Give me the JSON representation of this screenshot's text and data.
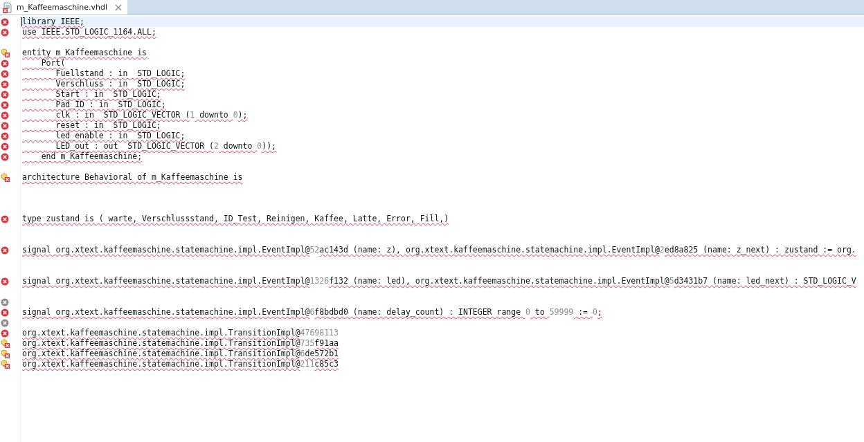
{
  "tab": {
    "title": "m_Kaffeemaschine.vhdl",
    "selected": true
  },
  "lines": [
    {
      "kind": "error",
      "current": true,
      "segments": [
        {
          "kind": "code",
          "text": "library IEEE;"
        }
      ]
    },
    {
      "kind": "error",
      "segments": [
        {
          "kind": "code",
          "text": "use IEEE.STD_LOGIC_1164.ALL;"
        }
      ]
    },
    {
      "kind": "plain"
    },
    {
      "kind": "quickfix",
      "segments": [
        {
          "kind": "code",
          "text": "entity m_Kaffeemaschine is"
        }
      ]
    },
    {
      "kind": "error",
      "segments": [
        {
          "kind": "code",
          "text": "    Port("
        }
      ]
    },
    {
      "kind": "error",
      "segments": [
        {
          "kind": "code",
          "text": "       Fuellstand : in  STD_LOGIC;"
        }
      ]
    },
    {
      "kind": "error",
      "segments": [
        {
          "kind": "code",
          "text": "       Verschluss : in  STD_LOGIC;"
        }
      ]
    },
    {
      "kind": "error",
      "segments": [
        {
          "kind": "code",
          "text": "       Start : in  STD_LOGIC;"
        }
      ]
    },
    {
      "kind": "error",
      "segments": [
        {
          "kind": "code",
          "text": "       Pad_ID : in  STD_LOGIC;"
        }
      ]
    },
    {
      "kind": "error",
      "segments": [
        {
          "kind": "code",
          "text": "       clk : in  STD_LOGIC_VECTOR ("
        },
        {
          "kind": "number",
          "text": "1"
        },
        {
          "kind": "code",
          "text": " downto "
        },
        {
          "kind": "number",
          "text": "0"
        },
        {
          "kind": "code",
          "text": ");"
        }
      ]
    },
    {
      "kind": "error",
      "segments": [
        {
          "kind": "code",
          "text": "       reset : in  STD_LOGIC;"
        }
      ]
    },
    {
      "kind": "error",
      "segments": [
        {
          "kind": "code",
          "text": "       led_enable : in  STD_LOGIC;"
        }
      ]
    },
    {
      "kind": "error",
      "segments": [
        {
          "kind": "code",
          "text": "       LED_out : out  STD_LOGIC_VECTOR ("
        },
        {
          "kind": "number",
          "text": "2"
        },
        {
          "kind": "code",
          "text": " downto "
        },
        {
          "kind": "number",
          "text": "0"
        },
        {
          "kind": "code",
          "text": "));"
        }
      ]
    },
    {
      "kind": "error",
      "segments": [
        {
          "kind": "code",
          "text": "    end m_Kaffeemaschine;"
        }
      ]
    },
    {
      "kind": "plain"
    },
    {
      "kind": "quickfix",
      "segments": [
        {
          "kind": "code",
          "text": "architecture Behavioral of m_Kaffeemaschine is"
        }
      ]
    },
    {
      "kind": "plain"
    },
    {
      "kind": "plain"
    },
    {
      "kind": "plain"
    },
    {
      "kind": "error",
      "segments": [
        {
          "kind": "code",
          "text": "type zustand is ( warte, Verschlussstand, ID_Test, Reinigen, Kaffee, Latte, Error, Fill,)"
        }
      ]
    },
    {
      "kind": "plain"
    },
    {
      "kind": "plain"
    },
    {
      "kind": "error",
      "segments": [
        {
          "kind": "code",
          "text": "signal org.xtext.kaffeemaschine.statemachine.impl.EventImpl@"
        },
        {
          "kind": "number",
          "text": "52"
        },
        {
          "kind": "code",
          "text": "ac143d (name: z), org.xtext.kaffeemaschine.statemachine.impl.EventImpl@"
        },
        {
          "kind": "number",
          "text": "2"
        },
        {
          "kind": "code",
          "text": "ed8a825 (name: z_next) : zustand := org."
        }
      ]
    },
    {
      "kind": "plain"
    },
    {
      "kind": "plain"
    },
    {
      "kind": "error",
      "segments": [
        {
          "kind": "code",
          "text": "signal org.xtext.kaffeemaschine.statemachine.impl.EventImpl@"
        },
        {
          "kind": "number",
          "text": "1326"
        },
        {
          "kind": "code",
          "text": "f132 (name: led), org.xtext.kaffeemaschine.statemachine.impl.EventImpl@"
        },
        {
          "kind": "number",
          "text": "5"
        },
        {
          "kind": "code",
          "text": "d3431b7 (name: led_next) : STD_LOGIC_V"
        }
      ]
    },
    {
      "kind": "plain"
    },
    {
      "kind": "inactive"
    },
    {
      "kind": "error",
      "segments": [
        {
          "kind": "code",
          "text": "signal org.xtext.kaffeemaschine.statemachine.impl.EventImpl@"
        },
        {
          "kind": "number",
          "text": "6"
        },
        {
          "kind": "code",
          "text": "f8bdbd0 (name: delay_count) : INTEGER range "
        },
        {
          "kind": "number",
          "text": "0"
        },
        {
          "kind": "code",
          "text": " to "
        },
        {
          "kind": "number",
          "text": "59999"
        },
        {
          "kind": "code",
          "text": " := "
        },
        {
          "kind": "number",
          "text": "0"
        },
        {
          "kind": "code",
          "text": ";"
        }
      ]
    },
    {
      "kind": "inactive"
    },
    {
      "kind": "error",
      "segments": [
        {
          "kind": "code",
          "text": "org.xtext.kaffeemaschine.statemachine.impl.TransitionImpl@"
        },
        {
          "kind": "number",
          "text": "47698113"
        }
      ]
    },
    {
      "kind": "quickfix",
      "segments": [
        {
          "kind": "code",
          "text": "org.xtext.kaffeemaschine.statemachine.impl.TransitionImpl@"
        },
        {
          "kind": "number",
          "text": "735"
        },
        {
          "kind": "code",
          "text": "f91aa"
        }
      ]
    },
    {
      "kind": "quickfix",
      "segments": [
        {
          "kind": "code",
          "text": "org.xtext.kaffeemaschine.statemachine.impl.TransitionImpl@"
        },
        {
          "kind": "number",
          "text": "6"
        },
        {
          "kind": "code",
          "text": "de572b1"
        }
      ]
    },
    {
      "kind": "quickfix",
      "segments": [
        {
          "kind": "code",
          "text": "org.xtext.kaffeemaschine.statemachine.impl.TransitionImpl@"
        },
        {
          "kind": "number",
          "text": "211"
        },
        {
          "kind": "code",
          "text": "c85c3"
        }
      ]
    }
  ]
}
